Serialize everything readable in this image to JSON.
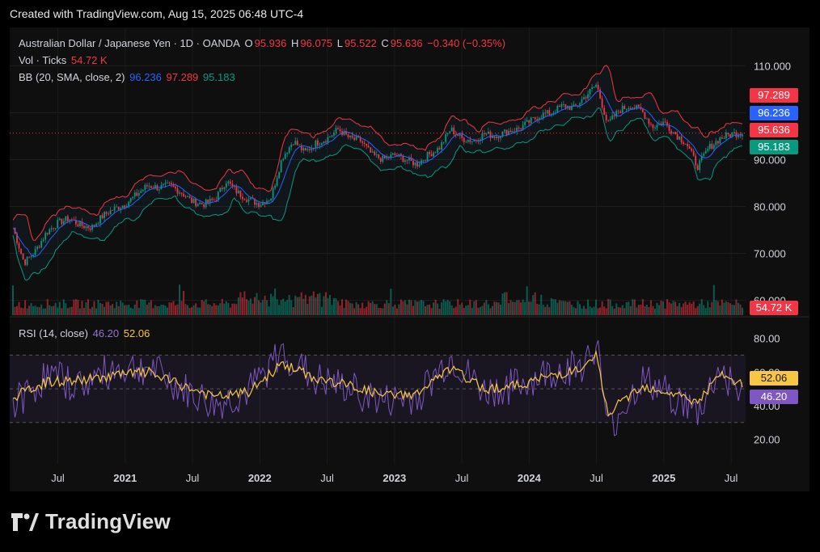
{
  "created_text": "Created with TradingView.com, Aug 15, 2025 06:48 UTC-4",
  "brand": "TradingView",
  "legend": {
    "symbol": "Australian Dollar / Japanese Yen · 1D · OANDA",
    "o_label": "O",
    "o": "95.936",
    "h_label": "H",
    "h": "96.075",
    "l_label": "L",
    "l": "95.522",
    "c_label": "C",
    "c": "95.636",
    "change": "−0.340 (−0.35%)",
    "vol_label": "Vol · Ticks",
    "vol": "54.72 K",
    "bb_label": "BB (20, SMA, close, 2)",
    "bb_mid": "96.236",
    "bb_upper": "97.289",
    "bb_lower": "95.183",
    "rsi_label": "RSI (14, close)",
    "rsi": "46.20",
    "rsi_ma": "52.06"
  },
  "badges": {
    "bb_upper": "97.289",
    "bb_mid": "96.236",
    "last_close": "95.636",
    "bb_lower": "95.183",
    "volume": "54.72 K",
    "rsi_ma": "52.06",
    "rsi": "46.20"
  },
  "colors": {
    "up": "#089981",
    "down": "#f23645",
    "bb_upper": "#f23645",
    "bb_mid": "#2962ff",
    "bb_lower": "#089981",
    "rsi": "#7e57c2",
    "rsi_ma": "#f7c744",
    "background": "#0f0f0f"
  },
  "chart_data": [
    {
      "type": "line",
      "name": "price",
      "x_ticks": [
        "Jul",
        "2021",
        "Jul",
        "2022",
        "Jul",
        "2023",
        "Jul",
        "2024",
        "Jul",
        "2025",
        "Jul"
      ],
      "y_ticks": [
        "110.000",
        "100.000",
        "90.000",
        "80.000",
        "70.000",
        "60.000"
      ],
      "ylim": [
        57,
        113
      ],
      "x_start": "2020-03",
      "x_end": "2025-08",
      "x": [
        "2020-03",
        "2020-04",
        "2020-05",
        "2020-06",
        "2020-07",
        "2020-08",
        "2020-09",
        "2020-10",
        "2020-11",
        "2020-12",
        "2021-01",
        "2021-02",
        "2021-03",
        "2021-04",
        "2021-05",
        "2021-06",
        "2021-07",
        "2021-08",
        "2021-09",
        "2021-10",
        "2021-11",
        "2021-12",
        "2022-01",
        "2022-02",
        "2022-03",
        "2022-04",
        "2022-05",
        "2022-06",
        "2022-07",
        "2022-08",
        "2022-09",
        "2022-10",
        "2022-11",
        "2022-12",
        "2023-01",
        "2023-02",
        "2023-03",
        "2023-04",
        "2023-05",
        "2023-06",
        "2023-07",
        "2023-08",
        "2023-09",
        "2023-10",
        "2023-11",
        "2023-12",
        "2024-01",
        "2024-02",
        "2024-03",
        "2024-04",
        "2024-05",
        "2024-06",
        "2024-07",
        "2024-08",
        "2024-09",
        "2024-10",
        "2024-11",
        "2024-12",
        "2025-01",
        "2025-02",
        "2025-03",
        "2025-04",
        "2025-05",
        "2025-06",
        "2025-07",
        "2025-08"
      ],
      "series": [
        {
          "values": [
            75.5,
            68.0,
            70.5,
            74.5,
            76.5,
            77.5,
            76.0,
            75.5,
            78.0,
            79.5,
            80.5,
            82.5,
            84.5,
            84.0,
            84.5,
            83.0,
            81.0,
            80.5,
            81.5,
            85.5,
            83.0,
            81.5,
            80.5,
            82.0,
            90.5,
            94.0,
            91.5,
            93.5,
            94.5,
            96.5,
            94.5,
            94.0,
            91.0,
            90.0,
            91.0,
            90.0,
            89.0,
            91.0,
            92.5,
            96.5,
            94.5,
            94.0,
            95.5,
            95.0,
            96.0,
            96.5,
            98.0,
            99.5,
            100.0,
            101.5,
            101.0,
            103.5,
            106.0,
            97.5,
            100.5,
            101.5,
            100.5,
            97.0,
            98.0,
            95.5,
            93.5,
            88.5,
            92.5,
            94.5,
            95.5,
            95.6
          ]
        }
      ]
    },
    {
      "type": "line",
      "name": "rsi",
      "y_ticks": [
        "80.00",
        "60.00",
        "40.00",
        "20.00"
      ],
      "bands": [
        70,
        30
      ],
      "ylim": [
        15,
        87
      ],
      "x": [
        "2020-03",
        "2020-06",
        "2020-09",
        "2020-12",
        "2021-03",
        "2021-06",
        "2021-09",
        "2021-12",
        "2022-03",
        "2022-06",
        "2022-09",
        "2022-12",
        "2023-03",
        "2023-06",
        "2023-09",
        "2023-12",
        "2024-03",
        "2024-06",
        "2024-07",
        "2024-08",
        "2024-11",
        "2025-02",
        "2025-04",
        "2025-06",
        "2025-08"
      ],
      "series": [
        {
          "values": [
            40,
            58,
            52,
            62,
            63,
            50,
            40,
            48,
            72,
            55,
            50,
            42,
            45,
            68,
            48,
            52,
            60,
            65,
            78,
            25,
            55,
            45,
            35,
            62,
            46
          ]
        },
        {
          "values": [
            45,
            54,
            55,
            58,
            60,
            52,
            45,
            48,
            65,
            56,
            52,
            46,
            47,
            62,
            50,
            52,
            58,
            62,
            70,
            35,
            52,
            47,
            42,
            58,
            52
          ]
        }
      ]
    }
  ]
}
